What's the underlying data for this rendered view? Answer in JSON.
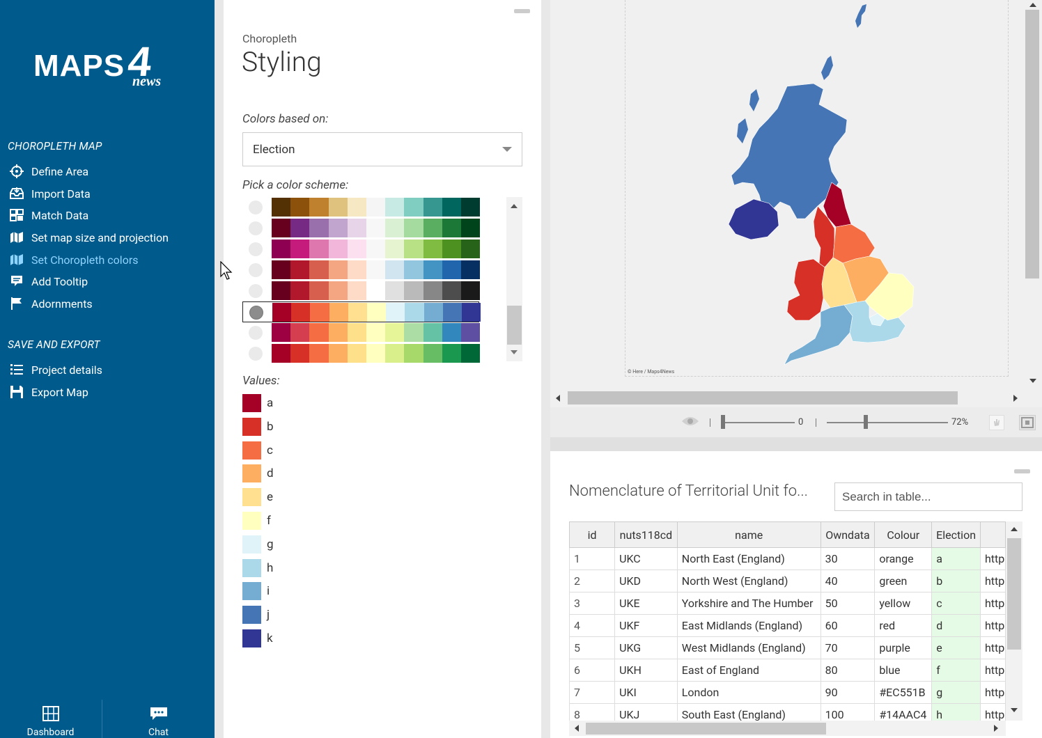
{
  "sidebar": {
    "brand": {
      "maps": "MAPS",
      "four": "4",
      "news": "news"
    },
    "sections": [
      {
        "title": "CHOROPLETH MAP"
      },
      {
        "title": "SAVE AND EXPORT"
      }
    ],
    "items": [
      {
        "label": "Define Area",
        "icon": "crosshair-icon"
      },
      {
        "label": "Import Data",
        "icon": "inbox-icon"
      },
      {
        "label": "Match Data",
        "icon": "match-icon"
      },
      {
        "label": "Set map size and projection",
        "icon": "map-icon"
      },
      {
        "label": "Set Choropleth colors",
        "icon": "palette-map-icon",
        "active": true
      },
      {
        "label": "Add Tooltip",
        "icon": "tooltip-icon"
      },
      {
        "label": "Adornments",
        "icon": "flag-icon"
      },
      {
        "label": "Project details",
        "icon": "list-icon"
      },
      {
        "label": "Export Map",
        "icon": "save-icon"
      }
    ],
    "bottom": {
      "dashboard": "Dashboard",
      "chat": "Chat"
    }
  },
  "styling": {
    "subtitle": "Choropleth",
    "title": "Styling",
    "colors_based_on_label": "Colors based on:",
    "colors_based_on_value": "Election",
    "pick_scheme_label": "Pick a color scheme:",
    "schemes": [
      [
        "#543005",
        "#8c510a",
        "#bf812d",
        "#dfc27d",
        "#f6e8c3",
        "#f5f5f5",
        "#c7eae5",
        "#80cdc1",
        "#35978f",
        "#01665e",
        "#003c30"
      ],
      [
        "#67001f",
        "#762a83",
        "#9970ab",
        "#c2a5cf",
        "#e7d4e8",
        "#f7f7f7",
        "#d9f0d3",
        "#a6dba0",
        "#5aae61",
        "#1b7837",
        "#00441b"
      ],
      [
        "#8e0152",
        "#c51b7d",
        "#de77ae",
        "#f1b6da",
        "#fde0ef",
        "#f7f7f7",
        "#e6f5d0",
        "#b8e186",
        "#7fbc41",
        "#4d9221",
        "#276419"
      ],
      [
        "#67001f",
        "#b2182b",
        "#d6604d",
        "#f4a582",
        "#fddbc7",
        "#f7f7f7",
        "#d1e5f0",
        "#92c5de",
        "#4393c3",
        "#2166ac",
        "#053061"
      ],
      [
        "#67001f",
        "#b2182b",
        "#d6604d",
        "#f4a582",
        "#fddbc7",
        "#ffffff",
        "#e0e0e0",
        "#bababa",
        "#878787",
        "#4d4d4d",
        "#1a1a1a"
      ],
      [
        "#a50026",
        "#d73027",
        "#f46d43",
        "#fdae61",
        "#fee090",
        "#ffffbf",
        "#e0f3f8",
        "#abd9e9",
        "#74add1",
        "#4575b4",
        "#313695"
      ],
      [
        "#9e0142",
        "#d53e4f",
        "#f46d43",
        "#fdae61",
        "#fee08b",
        "#ffffbf",
        "#e6f598",
        "#abdda4",
        "#66c2a5",
        "#3288bd",
        "#5e4fa2"
      ],
      [
        "#a50026",
        "#d73027",
        "#f46d43",
        "#fdae61",
        "#fee08b",
        "#ffffbf",
        "#d9ef8b",
        "#a6d96a",
        "#66bd63",
        "#1a9850",
        "#006837"
      ]
    ],
    "selected_scheme": 5,
    "values_label": "Values:",
    "values": [
      {
        "label": "a",
        "color": "#a50026"
      },
      {
        "label": "b",
        "color": "#d73027"
      },
      {
        "label": "c",
        "color": "#f46d43"
      },
      {
        "label": "d",
        "color": "#fdae61"
      },
      {
        "label": "e",
        "color": "#fee090"
      },
      {
        "label": "f",
        "color": "#ffffbf"
      },
      {
        "label": "g",
        "color": "#e0f3f8"
      },
      {
        "label": "h",
        "color": "#abd9e9"
      },
      {
        "label": "i",
        "color": "#74add1"
      },
      {
        "label": "j",
        "color": "#4575b4"
      },
      {
        "label": "k",
        "color": "#313695"
      }
    ]
  },
  "map": {
    "credit": "© Here / Maps4News",
    "rotation_value": "0",
    "zoom_value": "72%",
    "region_colors": {
      "scotland": "#4575b4",
      "northern_ireland": "#313695",
      "north_east": "#a50026",
      "north_west": "#d73027",
      "yorkshire": "#f46d43",
      "east_midlands": "#fdae61",
      "west_midlands": "#fee090",
      "east_of_england": "#ffffbf",
      "wales": "#d73027",
      "south_west": "#74add1",
      "south_east": "#abd9e9",
      "london": "#e0f3f8"
    }
  },
  "table": {
    "title": "Nomenclature of Territorial Unit fo...",
    "search_placeholder": "Search in table...",
    "columns": [
      "id",
      "nuts118cd",
      "name",
      "Owndata",
      "Colour",
      "Election",
      ""
    ],
    "rows": [
      [
        "1",
        "UKC",
        "North East (England)",
        "30",
        "orange",
        "a",
        "http"
      ],
      [
        "2",
        "UKD",
        "North West (England)",
        "40",
        "green",
        "b",
        "http"
      ],
      [
        "3",
        "UKE",
        "Yorkshire and The Humber",
        "50",
        "yellow",
        "c",
        "http"
      ],
      [
        "4",
        "UKF",
        "East Midlands (England)",
        "60",
        "red",
        "d",
        "http"
      ],
      [
        "5",
        "UKG",
        "West Midlands (England)",
        "70",
        "purple",
        "e",
        "http"
      ],
      [
        "6",
        "UKH",
        "East of England",
        "80",
        "blue",
        "f",
        "http"
      ],
      [
        "7",
        "UKI",
        "London",
        "90",
        "#EC551B",
        "g",
        "http"
      ],
      [
        "8",
        "UKJ",
        "South East (England)",
        "100",
        "#14AAC4",
        "h",
        "http"
      ]
    ]
  }
}
